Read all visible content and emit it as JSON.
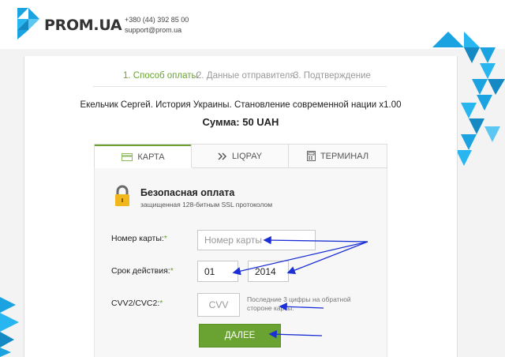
{
  "header": {
    "brand": "PROM.UA",
    "phone": "+380 (44) 392 85 00",
    "email": "support@prom.ua"
  },
  "steps": [
    {
      "label": "1. Способ оплаты",
      "active": true
    },
    {
      "label": "2. Данные отправителя",
      "active": false
    },
    {
      "label": "3. Подтверждение",
      "active": false
    }
  ],
  "order": {
    "product": "Екельчик Сергей. История Украины. Становление современной нации x1.00",
    "amount": "Сумма: 50 UAH"
  },
  "tabs": [
    {
      "label": "КАРТА",
      "icon": "credit-card-icon",
      "active": true
    },
    {
      "label": "LIQPAY",
      "icon": "double-chevron-icon",
      "active": false
    },
    {
      "label": "ТЕРМИНАЛ",
      "icon": "terminal-icon",
      "active": false
    }
  ],
  "secure": {
    "title": "Безопасная оплата",
    "subtitle": "защищенная 128-битным SSL протоколом",
    "icon": "padlock-icon"
  },
  "form": {
    "card_number": {
      "label": "Номер карты:",
      "required_mark": "*",
      "placeholder": "Номер карты",
      "value": ""
    },
    "expiry": {
      "label": "Срок действия:",
      "required_mark": "*",
      "month": "01",
      "year": "2014"
    },
    "cvv": {
      "label": "CVV2/CVC2:",
      "required_mark": "*",
      "placeholder": "CVV",
      "hint": "Последние 3 цифры на обратной стороне карты."
    },
    "submit_label": "ДАЛЕЕ"
  },
  "colors": {
    "accent_green": "#6aa331",
    "deco_blue": "#1aa3e0",
    "annotation_blue": "#1a2fd6"
  }
}
